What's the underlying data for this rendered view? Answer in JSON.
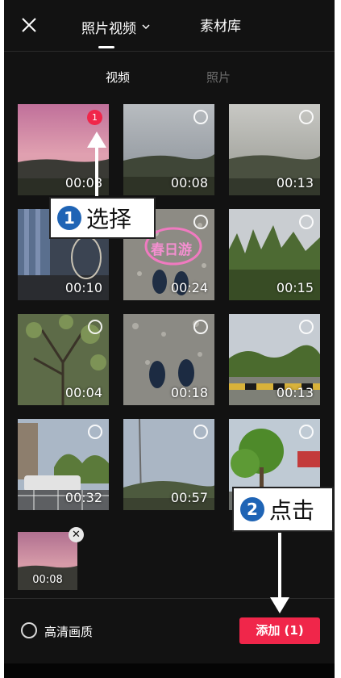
{
  "header": {
    "tab_main": "照片视频",
    "tab_library": "素材库"
  },
  "subtabs": {
    "video": "视频",
    "photo": "照片"
  },
  "grid": [
    {
      "duration": "00:08",
      "selected": true,
      "badge": "1"
    },
    {
      "duration": "00:08",
      "selected": false
    },
    {
      "duration": "00:13",
      "selected": false
    },
    {
      "duration": "00:10",
      "selected": false
    },
    {
      "duration": "00:24",
      "selected": false,
      "overlay_text": "春日游"
    },
    {
      "duration": "00:15",
      "selected": false
    },
    {
      "duration": "00:04",
      "selected": false
    },
    {
      "duration": "00:18",
      "selected": false
    },
    {
      "duration": "00:13",
      "selected": false
    },
    {
      "duration": "00:32",
      "selected": false
    },
    {
      "duration": "00:57",
      "selected": false
    },
    {
      "duration": "",
      "selected": false
    }
  ],
  "selected_tray": {
    "duration": "00:08",
    "remove_glyph": "✕"
  },
  "footer": {
    "hd_label": "高清画质",
    "add_button": "添加 (1)"
  },
  "annotations": {
    "step1": {
      "number": "1",
      "text": "选择"
    },
    "step2": {
      "number": "2",
      "text": "点击"
    }
  },
  "colors": {
    "accent": "#f0264a",
    "background": "#121212",
    "annotation_badge": "#1f64b5"
  },
  "icons": {
    "close": "close-icon",
    "dropdown": "chevron-down-icon"
  }
}
